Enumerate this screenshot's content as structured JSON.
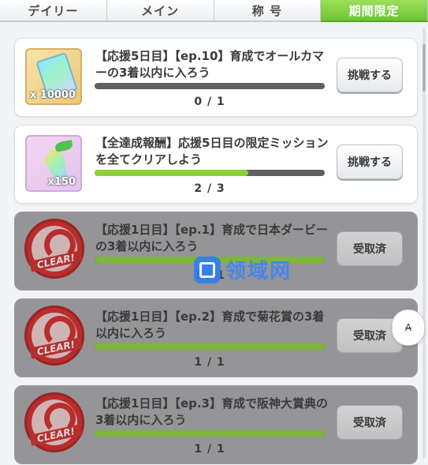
{
  "tabs": [
    {
      "label": "デイリー"
    },
    {
      "label": "メイン"
    },
    {
      "label": "称 号"
    },
    {
      "label": "期間限定"
    }
  ],
  "missions": [
    {
      "title": "【応援5日目】【ep.10】育成でオールカマーの3着以内に入ろう",
      "progress": 0.0,
      "count": "0 / 1",
      "button": "挑戦する",
      "reward_qty": "x 10000",
      "reward_icon": "ticket-icon",
      "state": "active"
    },
    {
      "title": "【全達成報酬】応援5日目の限定ミッションを全てクリアしよう",
      "progress": 0.667,
      "count": "2 / 3",
      "button": "挑戦する",
      "reward_qty": "x150",
      "reward_icon": "crystal-icon",
      "state": "active"
    },
    {
      "title": "【応援1日目】【ep.1】育成で日本ダービーの3着以内に入ろう",
      "progress": 1.0,
      "count": "1 / 1",
      "button": "受取済",
      "seal_text": "CLEAR!",
      "state": "done"
    },
    {
      "title": "【応援1日目】【ep.2】育成で菊花賞の3着以内に入ろう",
      "progress": 1.0,
      "count": "1 / 1",
      "button": "受取済",
      "seal_text": "CLEAR!",
      "state": "done"
    },
    {
      "title": "【応援1日目】【ep.3】育成で阪神大賞典の3着以内に入ろう",
      "progress": 1.0,
      "count": "1 / 1",
      "button": "受取済",
      "seal_text": "CLEAR!",
      "state": "done"
    }
  ],
  "watermark": {
    "text": "领域网"
  },
  "float_button": {
    "label": "A̶"
  }
}
